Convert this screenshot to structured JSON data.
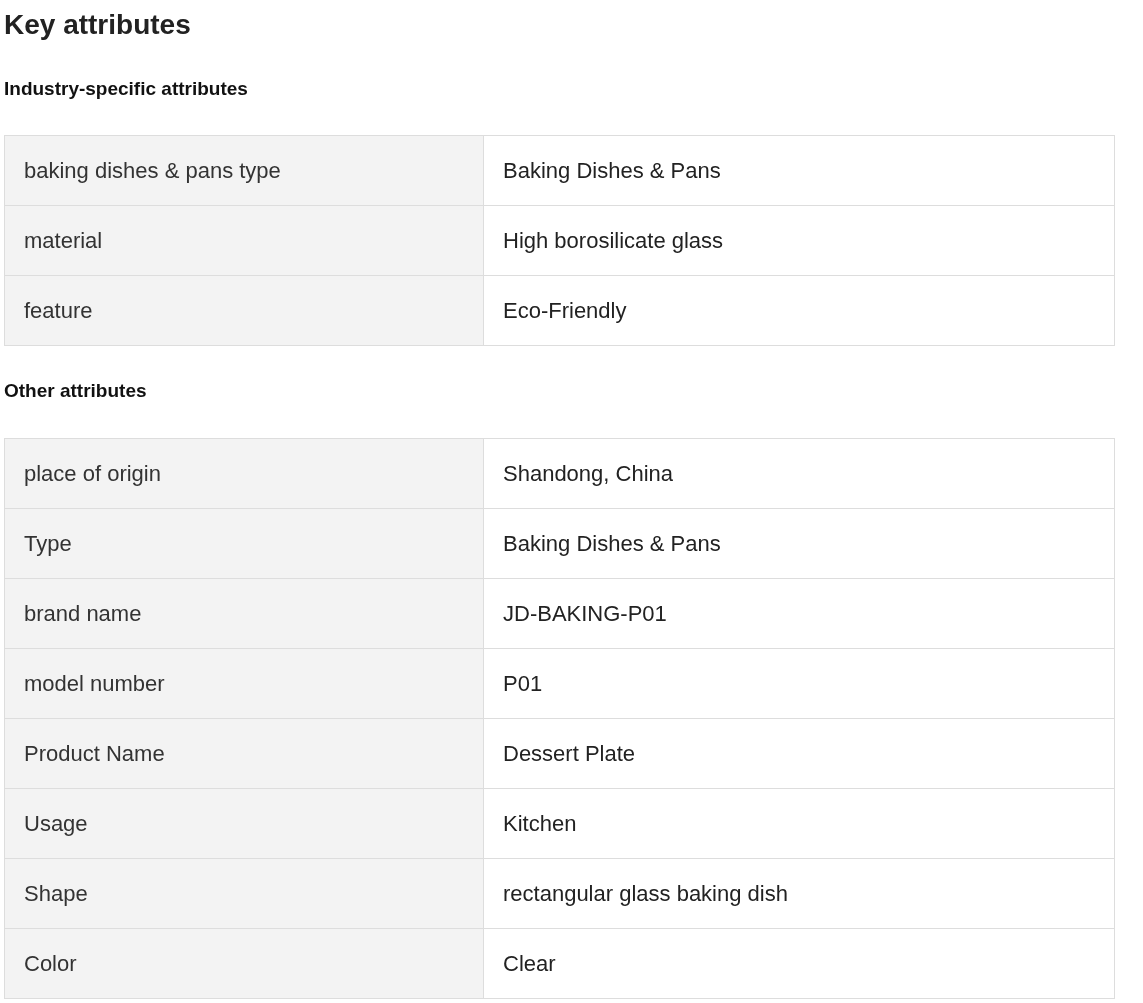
{
  "title": "Key attributes",
  "sections": [
    {
      "heading": "Industry-specific attributes",
      "rows": [
        {
          "name": "baking dishes & pans type",
          "value": "Baking Dishes & Pans"
        },
        {
          "name": "material",
          "value": "High borosilicate glass"
        },
        {
          "name": "feature",
          "value": "Eco-Friendly"
        }
      ]
    },
    {
      "heading": "Other attributes",
      "rows": [
        {
          "name": "place of origin",
          "value": "Shandong, China"
        },
        {
          "name": "Type",
          "value": "Baking Dishes & Pans"
        },
        {
          "name": "brand name",
          "value": "JD-BAKING-P01"
        },
        {
          "name": "model number",
          "value": "P01"
        },
        {
          "name": "Product Name",
          "value": "Dessert Plate"
        },
        {
          "name": "Usage",
          "value": "Kitchen"
        },
        {
          "name": "Shape",
          "value": "rectangular glass baking dish"
        },
        {
          "name": "Color",
          "value": "Clear"
        }
      ]
    }
  ]
}
